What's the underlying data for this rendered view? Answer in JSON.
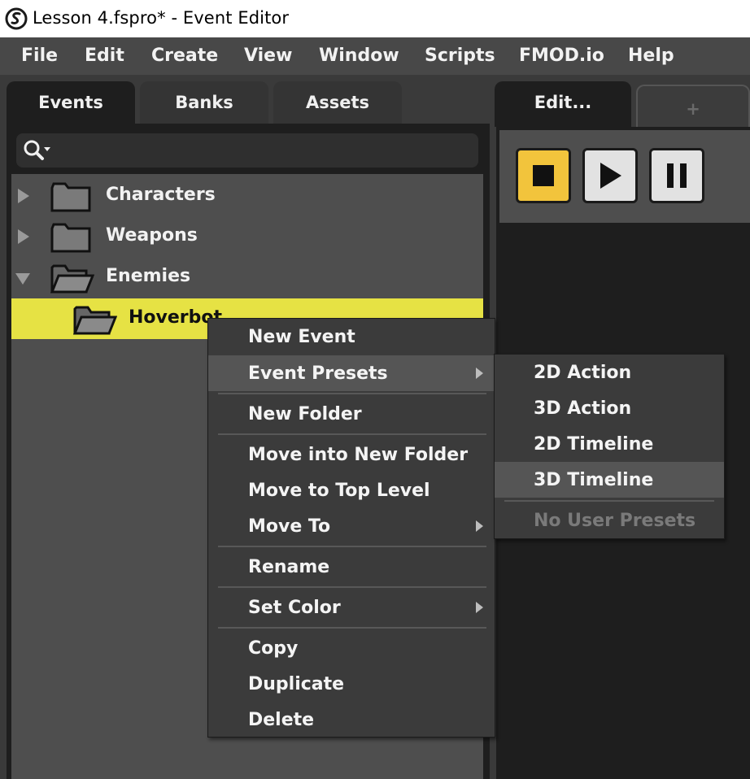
{
  "window": {
    "title": "Lesson 4.fspro* - Event Editor",
    "app_icon": "fmod-logo-icon"
  },
  "menubar": [
    "File",
    "Edit",
    "Create",
    "View",
    "Window",
    "Scripts",
    "FMOD.io",
    "Help"
  ],
  "browser_tabs": {
    "events": "Events",
    "banks": "Banks",
    "assets": "Assets",
    "active": "Events"
  },
  "search": {
    "placeholder": "",
    "icon": "search-icon"
  },
  "tree": {
    "characters": "Characters",
    "weapons": "Weapons",
    "enemies": "Enemies",
    "hoverbot": "Hoverbot",
    "selected": "Hoverbot",
    "selection_color": "#e6e244"
  },
  "editor_tabs": {
    "edit": "Edit...",
    "add": "+"
  },
  "transport": {
    "stop": "stop-icon",
    "play": "play-icon",
    "pause": "pause-icon",
    "stop_active_color": "#f2c43c"
  },
  "context_menu": {
    "new_event": "New Event",
    "event_presets": "Event Presets",
    "new_folder": "New Folder",
    "move_into_new_folder": "Move into New Folder",
    "move_to_top_level": "Move to Top Level",
    "move_to": "Move To",
    "rename": "Rename",
    "set_color": "Set Color",
    "copy": "Copy",
    "duplicate": "Duplicate",
    "delete": "Delete",
    "highlighted": "Event Presets"
  },
  "presets_submenu": {
    "action_2d": "2D Action",
    "action_3d": "3D Action",
    "timeline_2d": "2D Timeline",
    "timeline_3d": "3D Timeline",
    "no_user_presets": "No User Presets",
    "highlighted": "3D Timeline"
  }
}
